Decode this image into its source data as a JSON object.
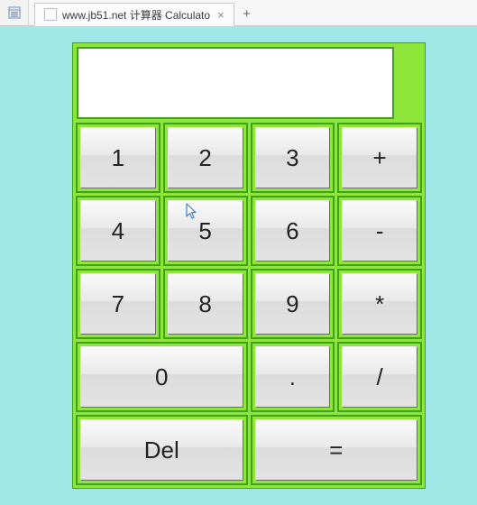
{
  "browser": {
    "tab_title": "www.jb51.net 计算器 Calculato",
    "close_glyph": "×",
    "newtab_glyph": "+"
  },
  "calculator": {
    "display_value": "",
    "buttons": {
      "k1": "1",
      "k2": "2",
      "k3": "3",
      "plus": "+",
      "k4": "4",
      "k5": "5",
      "k6": "6",
      "minus": "-",
      "k7": "7",
      "k8": "8",
      "k9": "9",
      "mul": "*",
      "k0": "0",
      "dot": ".",
      "div": "/",
      "del": "Del",
      "eq": "="
    }
  }
}
